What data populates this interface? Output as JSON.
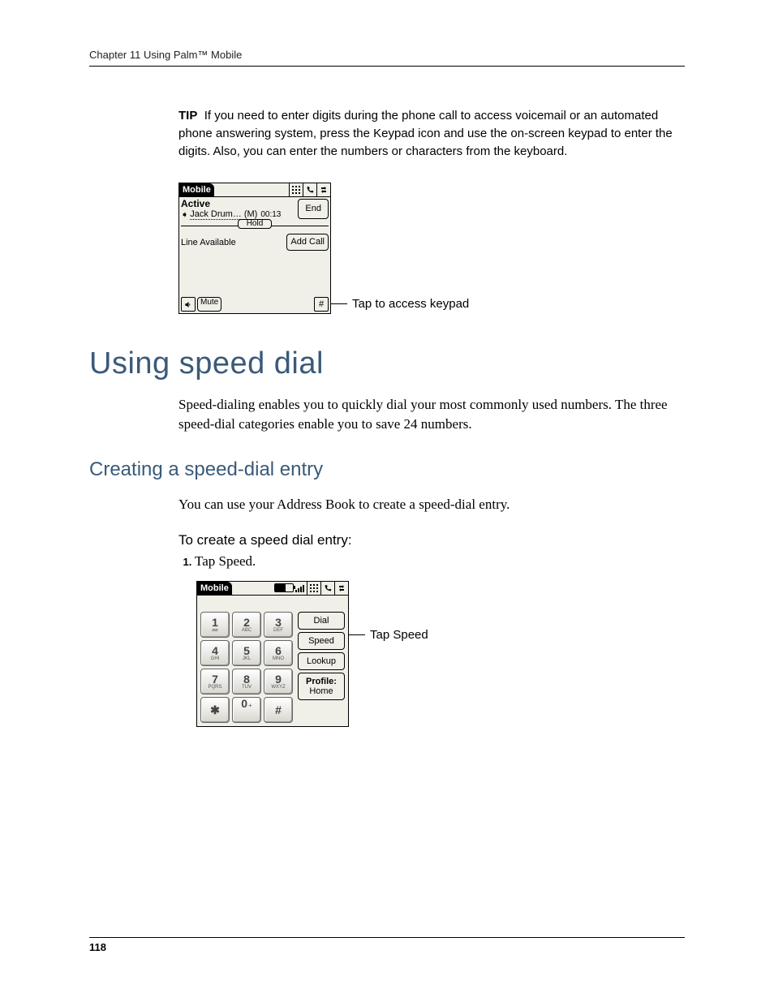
{
  "running_head": "Chapter 11   Using Palm™ Mobile",
  "tip": {
    "label": "TIP",
    "text": "If you need to enter digits during the phone call to access voicemail or an automated phone answering system, press the Keypad icon and use the on-screen keypad to enter the digits. Also, you can enter the numbers or characters from the keyboard."
  },
  "screen1": {
    "title": "Mobile",
    "status": "Active",
    "caller": "Jack Drum… (M)",
    "duration": "00:13",
    "end_btn": "End",
    "hold_btn": "Hold",
    "line_status": "Line Available",
    "add_call_btn": "Add Call",
    "mute_btn": "Mute",
    "hash_btn": "#",
    "callout": "Tap to access keypad"
  },
  "h1": "Using speed dial",
  "p1": "Speed-dialing enables you to quickly dial your most commonly used numbers. The three speed-dial categories enable you to save 24 numbers.",
  "h2": "Creating a speed-dial entry",
  "p2": "You can use your Address Book to create a speed-dial entry.",
  "proc_title": "To create a speed dial entry:",
  "step1": "Tap Speed.",
  "screen2": {
    "title": "Mobile",
    "keys": [
      {
        "d": "1",
        "s": "⌀⌀"
      },
      {
        "d": "2",
        "s": "ABC"
      },
      {
        "d": "3",
        "s": "DEF"
      },
      {
        "d": "4",
        "s": "GHI"
      },
      {
        "d": "5",
        "s": "JKL"
      },
      {
        "d": "6",
        "s": "MNO"
      },
      {
        "d": "7",
        "s": "PQRS"
      },
      {
        "d": "8",
        "s": "TUV"
      },
      {
        "d": "9",
        "s": "WXYZ"
      },
      {
        "d": "✱",
        "s": ""
      },
      {
        "d": "0",
        "s": "+"
      },
      {
        "d": "#",
        "s": ""
      }
    ],
    "side": {
      "dial": "Dial",
      "speed": "Speed",
      "lookup": "Lookup",
      "profile_label": "Profile:",
      "profile_value": "Home"
    },
    "callout": "Tap Speed"
  },
  "page_number": "118"
}
